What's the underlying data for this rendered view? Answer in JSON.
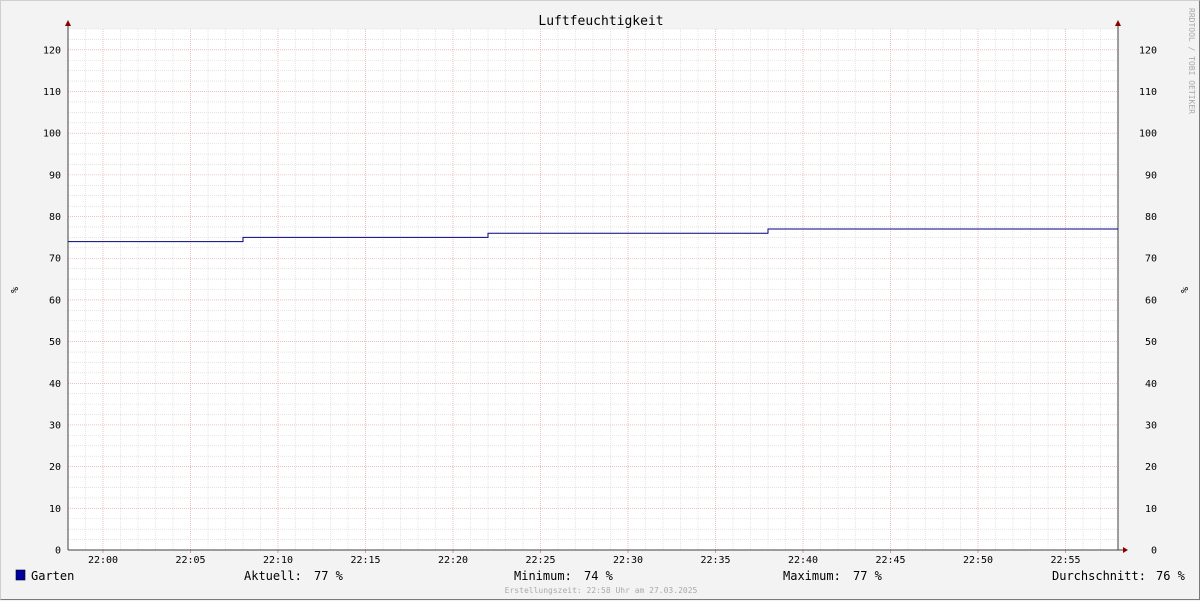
{
  "chart_data": {
    "type": "line",
    "title": "Luftfeuchtigkeit",
    "ylabel": "%",
    "ylim": [
      0,
      125
    ],
    "yticks": [
      0,
      10,
      20,
      30,
      40,
      50,
      60,
      70,
      80,
      90,
      100,
      110,
      120
    ],
    "xticks": [
      "22:00",
      "22:05",
      "22:10",
      "22:15",
      "22:20",
      "22:25",
      "22:30",
      "22:35",
      "22:40",
      "22:45",
      "22:50",
      "22:55"
    ],
    "xlim": [
      "21:58:00",
      "22:58:00"
    ],
    "series": [
      {
        "name": "Garten",
        "color": "#000080",
        "points": [
          [
            "21:58:00",
            74
          ],
          [
            "22:08:00",
            74
          ],
          [
            "22:08:00",
            75
          ],
          [
            "22:22:00",
            75
          ],
          [
            "22:22:00",
            76
          ],
          [
            "22:38:00",
            76
          ],
          [
            "22:38:00",
            77
          ],
          [
            "22:58:00",
            77
          ]
        ]
      }
    ],
    "grid": true,
    "legend": "bottom"
  },
  "legend": {
    "swatch_color": "#0000a0",
    "series_name": "Garten",
    "aktuell_label": "Aktuell:",
    "aktuell_value": "77 %",
    "minimum_label": "Minimum:",
    "minimum_value": "74 %",
    "maximum_label": "Maximum:",
    "maximum_value": "77 %",
    "durchschnitt_label": "Durchschnitt:",
    "durchschnitt_value": "76 %"
  },
  "footer": "Erstellungszeit: 22:58 Uhr am 27.03.2025",
  "watermark": "RRDTOOL / TOBI OETIKER"
}
